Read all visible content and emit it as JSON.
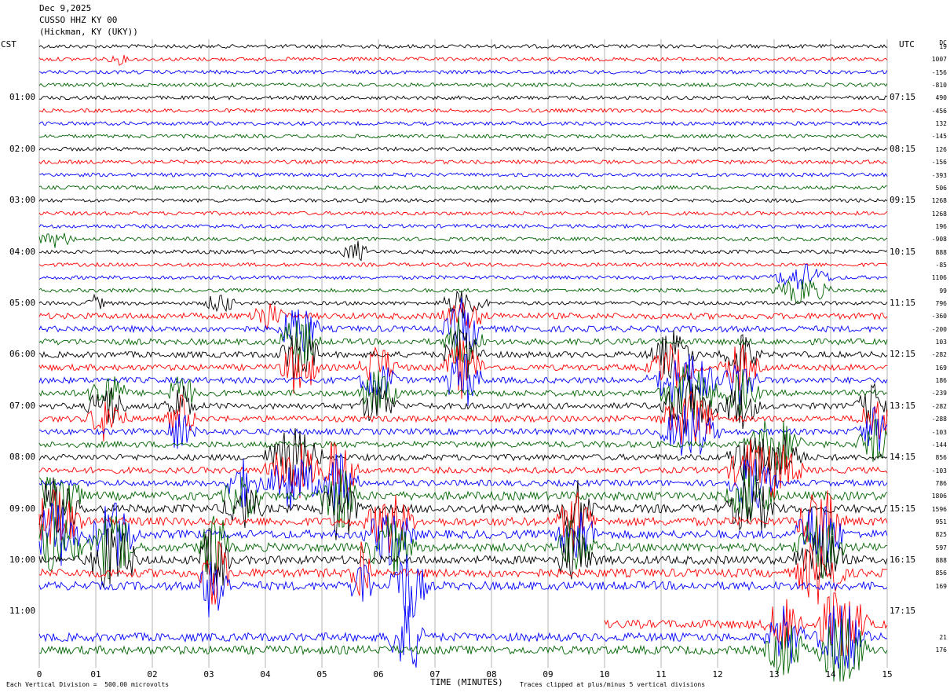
{
  "header": {
    "date": "Dec 9,2025",
    "station": "CUSSO HHZ KY 00",
    "location": "(Hickman, KY (UKY))"
  },
  "left_axis_label": "CST",
  "right_axis_label": "UTC",
  "dc_label": "DC",
  "footer": {
    "scale_note": "Each Vertical Division =  500.00 microvolts",
    "clip_note": "Traces clipped at plus/minus 5 vertical divisions",
    "xlabel": "TIME (MINUTES)"
  },
  "colors": {
    "series": [
      "#000000",
      "#ff0000",
      "#0000ff",
      "#006400"
    ],
    "grid": "#808080"
  },
  "chart_data": {
    "type": "line",
    "title": "Dec 9,2025 CUSSO HHZ KY 00 (Hickman, KY (UKY))",
    "xlabel": "TIME (MINUTES)",
    "xlim": [
      0,
      15
    ],
    "x_ticks": [
      "0",
      "01",
      "02",
      "03",
      "04",
      "05",
      "06",
      "07",
      "08",
      "09",
      "10",
      "11",
      "12",
      "13",
      "14",
      "15"
    ],
    "y_left_ticks": [
      "01:00",
      "02:00",
      "03:00",
      "04:00",
      "05:00",
      "06:00",
      "07:00",
      "08:00",
      "09:00",
      "10:00",
      "11:00"
    ],
    "y_right_ticks": [
      "07:15",
      "08:15",
      "09:15",
      "10:15",
      "11:15",
      "12:15",
      "13:15",
      "14:15",
      "15:15",
      "16:15",
      "17:15"
    ],
    "dc_offsets": [
      "19",
      "1007",
      "-156",
      "-810",
      "490",
      "-456",
      "132",
      "-145",
      "126",
      "-156",
      "-393",
      "506",
      "1268",
      "1268",
      "196",
      "-908",
      "888",
      "-85",
      "1106",
      "99",
      "796",
      "-360",
      "-200",
      "103",
      "-282",
      "169",
      "186",
      "-239",
      "-282",
      "-288",
      "-103",
      "-144",
      "856",
      "-103",
      "786",
      "1806",
      "1596",
      "951",
      "825",
      "597",
      "888",
      "856",
      "169",
      "",
      "",
      "",
      "21",
      "176"
    ],
    "trace_count": 48,
    "minutes_per_trace": 15
  }
}
